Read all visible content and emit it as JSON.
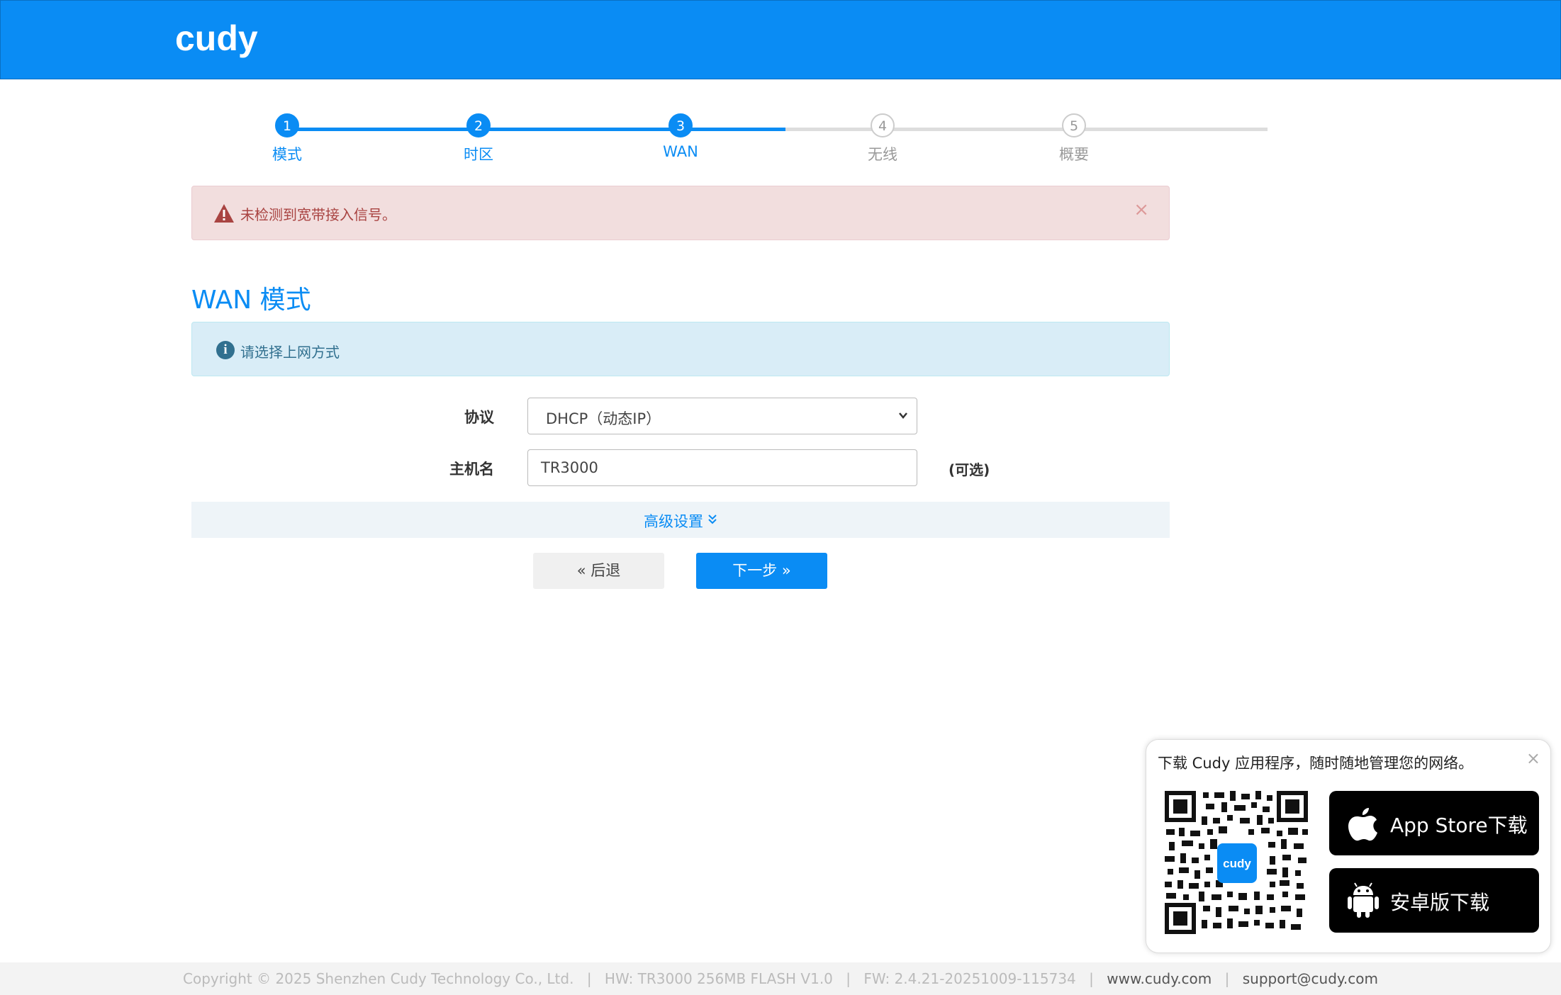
{
  "header": {
    "logo_text": "cudy",
    "brand_color": "#0a8cf4"
  },
  "steps": [
    {
      "number": "1",
      "label": "模式",
      "status": "done"
    },
    {
      "number": "2",
      "label": "时区",
      "status": "done"
    },
    {
      "number": "3",
      "label": "WAN",
      "status": "current"
    },
    {
      "number": "4",
      "label": "无线",
      "status": "todo"
    },
    {
      "number": "5",
      "label": "概要",
      "status": "todo"
    }
  ],
  "alert_danger": {
    "icon": "warning-triangle-icon",
    "message": "未检测到宽带接入信号。",
    "close": "×"
  },
  "section": {
    "title": "WAN 模式"
  },
  "alert_info": {
    "icon": "info-icon",
    "message": "请选择上网方式"
  },
  "form": {
    "protocol_label": "协议",
    "protocol_value": "DHCP（动态IP）",
    "hostname_label": "主机名",
    "hostname_value": "TR3000",
    "hostname_hint": "(可选)",
    "advanced_label": "高级设置"
  },
  "buttons": {
    "back": "« 后退",
    "next": "下一步 »"
  },
  "app_popup": {
    "title": "下载 Cudy 应用程序，随时随地管理您的网络。",
    "close": "×",
    "qr_logo": "cudy",
    "appstore_label": "App Store下载",
    "android_label": "安卓版下载"
  },
  "footer": {
    "copyright": "Copyright © 2025 Shenzhen Cudy Technology Co., Ltd.",
    "hw": "HW: TR3000 256MB FLASH V1.0",
    "fw": "FW: 2.4.21-20251009-115734",
    "website": "www.cudy.com",
    "email": "support@cudy.com",
    "separator": "|"
  }
}
